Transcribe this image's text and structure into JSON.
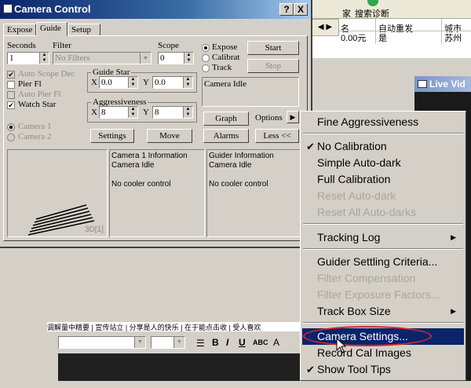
{
  "background_app": {
    "toolbar": {
      "left_text": "家",
      "search_label": "搜索诊断"
    },
    "nav_arrows": "◀ ▶",
    "table": {
      "headers": [
        "名",
        "自动重发",
        "城市"
      ],
      "row": [
        "0.00元",
        "是",
        "苏州"
      ]
    },
    "live_view_title": "Live Vid"
  },
  "camera_window": {
    "title": "Camera Control",
    "title_buttons": [
      "?",
      "X"
    ],
    "tabs": [
      "Expose",
      "Guide",
      "Setup"
    ],
    "active_tab": "Guide",
    "seconds": {
      "label": "Seconds",
      "value": "1"
    },
    "filter": {
      "label": "Filter",
      "value": "No Filters"
    },
    "scope": {
      "label": "Scope",
      "value": "0"
    },
    "mode_radios": [
      {
        "label": "Expose",
        "checked": true
      },
      {
        "label": "Calibrat",
        "checked": false
      },
      {
        "label": "Track",
        "checked": false
      }
    ],
    "start_button": "Start",
    "stop_button": "Stop",
    "checkboxes": [
      {
        "label": "Auto Scope Dec",
        "checked": true,
        "disabled": true
      },
      {
        "label": "Pier Fl",
        "checked": false,
        "disabled": false
      },
      {
        "label": "Auto Pier Fl",
        "checked": false,
        "disabled": true
      },
      {
        "label": "Watch Star",
        "checked": true,
        "disabled": false
      }
    ],
    "guide_star": {
      "label": "Guide Star",
      "x_label": "X",
      "x_value": "0.0",
      "y_label": "Y",
      "y_value": "0.0"
    },
    "aggressiveness": {
      "label": "Aggressiveness",
      "x_label": "X",
      "x_value": "8",
      "y_label": "Y",
      "y_value": "8"
    },
    "status_text": "Camera Idle",
    "graph_button": "Graph",
    "options_label": "Options",
    "camera_radios": [
      {
        "label": "Camera 1",
        "checked": true
      },
      {
        "label": "Camera 2",
        "checked": false
      }
    ],
    "settings_button": "Settings",
    "move_button": "Move",
    "alarms_button": "Alarms",
    "less_button": "Less <<",
    "camera1_info": [
      "Camera 1 Information",
      "Camera Idle",
      "No cooler control"
    ],
    "guider_info": [
      "Guider Information",
      "Camera Idle",
      "No cooler control"
    ],
    "scope_label": "3D[1]"
  },
  "context_menu": {
    "items": [
      {
        "label": "Fine Aggressiveness",
        "checked": false,
        "disabled": false
      },
      {
        "label": "No Calibration",
        "checked": true,
        "disabled": false
      },
      {
        "label": "Simple Auto-dark",
        "checked": false,
        "disabled": false
      },
      {
        "label": "Full Calibration",
        "checked": false,
        "disabled": false
      },
      {
        "label": "Reset Auto-dark",
        "checked": false,
        "disabled": true
      },
      {
        "label": "Reset All Auto-darks",
        "checked": false,
        "disabled": true
      },
      {
        "label": "Tracking Log",
        "checked": false,
        "disabled": false,
        "submenu": true
      },
      {
        "label": "Guider Settling Criteria...",
        "checked": false,
        "disabled": false
      },
      {
        "label": "Filter Compensation",
        "checked": false,
        "disabled": true
      },
      {
        "label": "Filter Exposure Factors...",
        "checked": false,
        "disabled": true
      },
      {
        "label": "Track Box Size",
        "checked": false,
        "disabled": false,
        "submenu": true
      },
      {
        "label": "Camera Settings...",
        "checked": false,
        "disabled": false,
        "highlighted": true
      },
      {
        "label": "Record Cal Images",
        "checked": false,
        "disabled": false
      },
      {
        "label": "Show Tool Tips",
        "checked": true,
        "disabled": false
      }
    ]
  },
  "lower_window": {
    "tabs_text": "调解量中精要 | 宣传站立 | 分享是人的快乐 | 在于能点击收 | 受人喜欢"
  },
  "colors": {
    "title_gradient_start": "#0a246a",
    "menu_highlight": "#0a246a",
    "annotation_circle": "#d9262c",
    "window_face": "#d4d0c8"
  }
}
